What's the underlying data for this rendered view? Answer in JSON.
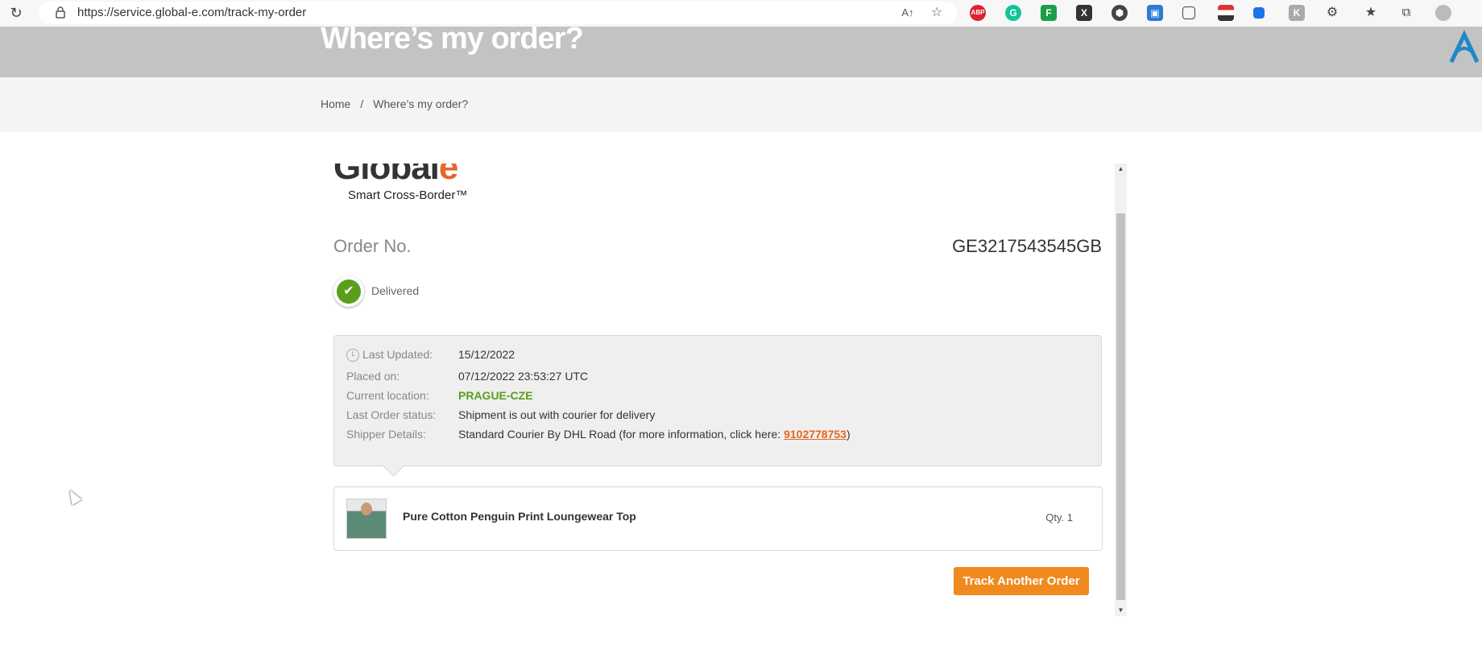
{
  "browser": {
    "url": "https://service.global-e.com/track-my-order",
    "toolbar_icons": [
      "read-aloud-icon",
      "favorite-add-icon",
      "adblock-icon",
      "grammarly-icon",
      "extension-green-icon",
      "extension-x-icon",
      "extension-hex-icon",
      "screenshot-icon",
      "collections-icon",
      "extension-flag-icon",
      "extension-blue-icon",
      "extension-gray-icon",
      "extensions-icon",
      "favorites-icon",
      "browser-collections-icon",
      "profile-icon"
    ],
    "adblock_label": "ABP"
  },
  "hero": {
    "title": "Where’s my order?"
  },
  "breadcrumb": {
    "home": "Home",
    "separator": "/",
    "current": "Where’s my order?"
  },
  "brand": {
    "logo_text_main": "Global",
    "logo_text_accent": "e",
    "tagline": "Smart Cross-Border™",
    "accent_color": "#e8662c"
  },
  "order": {
    "label": "Order No.",
    "number": "GE3217543545GB",
    "status": "Delivered",
    "status_color": "#5a9e1b"
  },
  "details": {
    "last_updated_label": "Last Updated:",
    "last_updated_value": "15/12/2022",
    "placed_on_label": "Placed on:",
    "placed_on_value": "07/12/2022 23:53:27 UTC",
    "current_location_label": "Current location:",
    "current_location_value": "PRAGUE-CZE",
    "last_status_label": "Last Order status:",
    "last_status_value": "Shipment is out with courier for delivery",
    "shipper_label": "Shipper Details:",
    "shipper_value_prefix": "Standard Courier By DHL Road (for more information, click here: ",
    "shipper_tracking_number": "9102778753",
    "shipper_value_suffix": ")"
  },
  "item": {
    "name": "Pure Cotton Penguin Print Loungewear Top",
    "qty": "Qty. 1"
  },
  "actions": {
    "track_another": "Track Another Order",
    "button_color": "#f08a1e"
  }
}
